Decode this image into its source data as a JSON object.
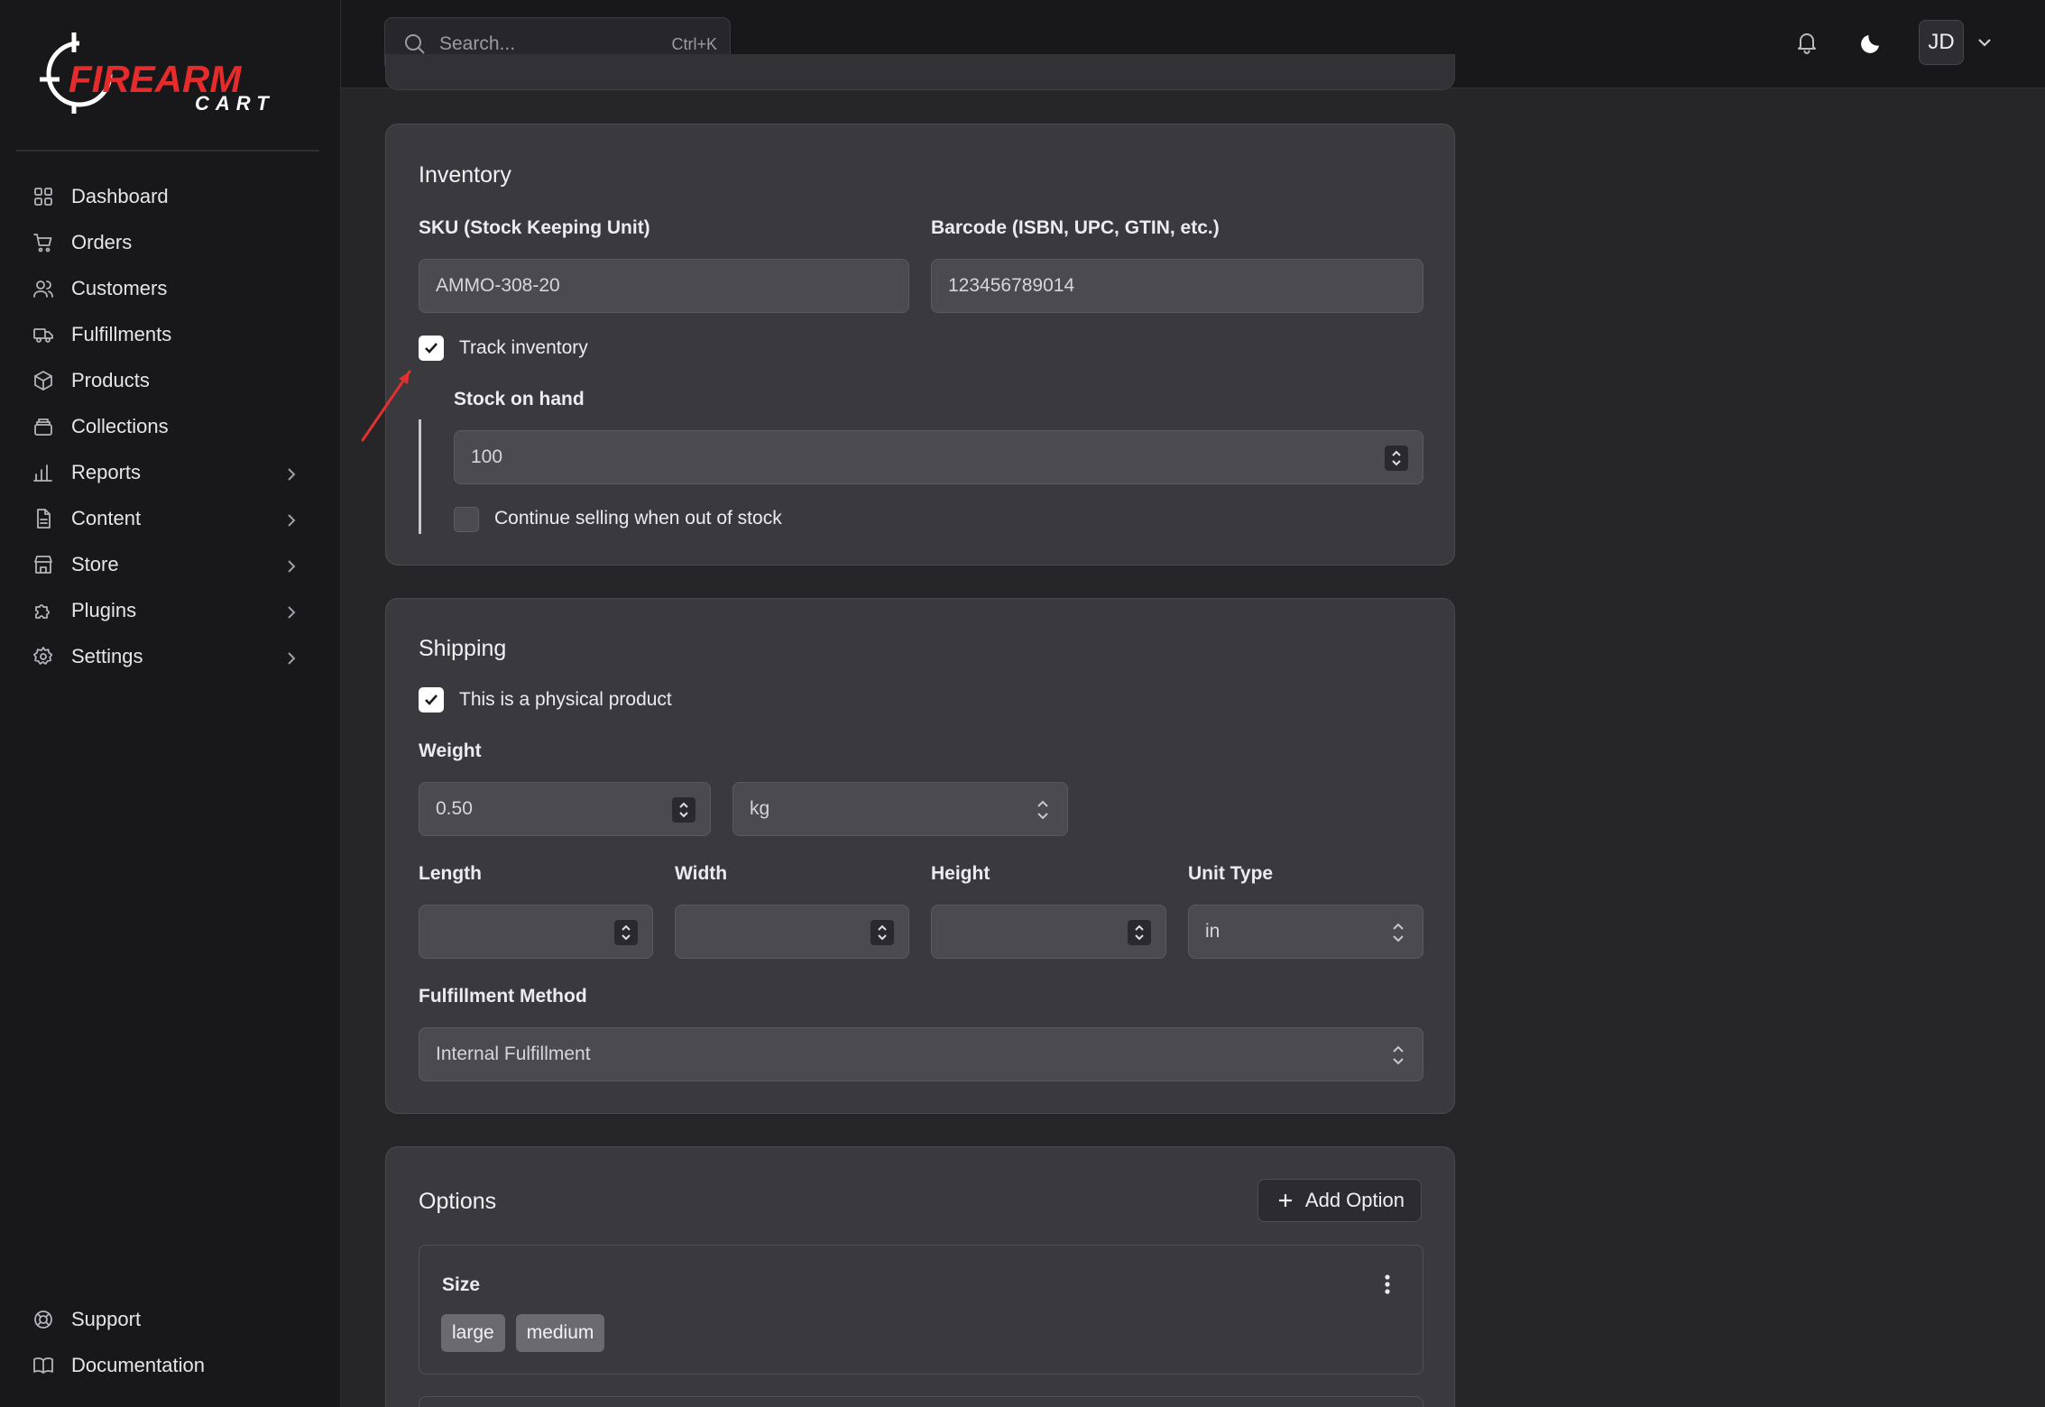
{
  "brand": {
    "name_top": "FIREARM",
    "name_bottom": "CART",
    "accent_color": "#e52b2b"
  },
  "search": {
    "placeholder": "Search...",
    "shortcut": "Ctrl+K"
  },
  "user": {
    "initials": "JD"
  },
  "sidebar": {
    "items": [
      {
        "label": "Dashboard",
        "icon": "dashboard-icon"
      },
      {
        "label": "Orders",
        "icon": "cart-icon"
      },
      {
        "label": "Customers",
        "icon": "users-icon"
      },
      {
        "label": "Fulfillments",
        "icon": "truck-icon"
      },
      {
        "label": "Products",
        "icon": "box-icon"
      },
      {
        "label": "Collections",
        "icon": "collection-icon"
      },
      {
        "label": "Reports",
        "icon": "bar-chart-icon"
      },
      {
        "label": "Content",
        "icon": "document-icon"
      },
      {
        "label": "Store",
        "icon": "store-icon"
      },
      {
        "label": "Plugins",
        "icon": "puzzle-icon"
      },
      {
        "label": "Settings",
        "icon": "gear-icon"
      }
    ],
    "bottom_items": [
      {
        "label": "Support",
        "icon": "lifebuoy-icon"
      },
      {
        "label": "Documentation",
        "icon": "book-icon"
      }
    ]
  },
  "inventory": {
    "title": "Inventory",
    "sku_label": "SKU (Stock Keeping Unit)",
    "sku_value": "AMMO-308-20",
    "barcode_label": "Barcode (ISBN, UPC, GTIN, etc.)",
    "barcode_value": "123456789014",
    "track_label": "Track inventory",
    "track_checked": true,
    "stock_label": "Stock on hand",
    "stock_value": "100",
    "continue_label": "Continue selling when out of stock",
    "continue_checked": false
  },
  "shipping": {
    "title": "Shipping",
    "physical_label": "This is a physical product",
    "physical_checked": true,
    "weight_label": "Weight",
    "weight_value": "0.50",
    "weight_unit": "kg",
    "length_label": "Length",
    "width_label": "Width",
    "height_label": "Height",
    "unit_type_label": "Unit Type",
    "unit_type_value": "in",
    "fulfillment_label": "Fulfillment Method",
    "fulfillment_value": "Internal Fulfillment"
  },
  "options": {
    "title": "Options",
    "add_label": "Add Option",
    "items": [
      {
        "name": "Size",
        "values": [
          "large",
          "medium"
        ]
      }
    ]
  }
}
